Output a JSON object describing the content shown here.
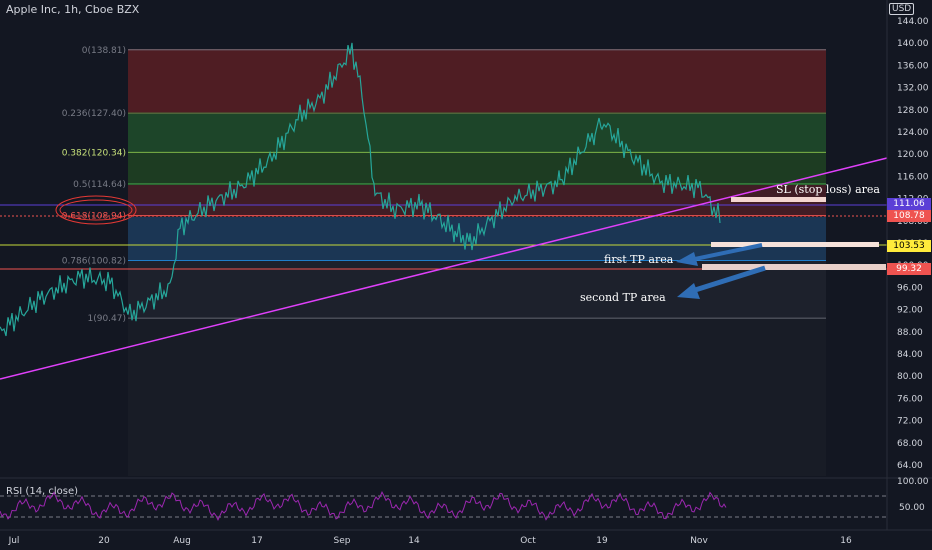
{
  "header": {
    "symbol_title": "Apple Inc, 1h, Cboe BZX",
    "currency": "USD"
  },
  "price_axis": {
    "ticks": [
      "144.00",
      "140.00",
      "136.00",
      "132.00",
      "128.00",
      "124.00",
      "120.00",
      "116.00",
      "112.00",
      "108.00",
      "104.00",
      "100.00",
      "96.00",
      "92.00",
      "88.00",
      "84.00",
      "80.00",
      "76.00",
      "72.00",
      "68.00",
      "64.00"
    ],
    "badges": [
      {
        "label": "111.06",
        "price": 111.06,
        "bg": "#5b3fd6",
        "fg": "#ffffff"
      },
      {
        "label": "108.78",
        "price": 108.78,
        "bg": "#ef5350",
        "fg": "#ffffff"
      },
      {
        "label": "103.53",
        "price": 103.53,
        "bg": "#ffeb3b",
        "fg": "#000000"
      },
      {
        "label": "99.32",
        "price": 99.32,
        "bg": "#ef5350",
        "fg": "#ffffff"
      }
    ]
  },
  "time_axis": {
    "labels": [
      "Jul",
      "20",
      "Aug",
      "17",
      "Sep",
      "14",
      "Oct",
      "19",
      "Nov",
      "16"
    ]
  },
  "fib_levels": [
    {
      "label": "0(138.81)",
      "ratio": 0,
      "price": 138.81
    },
    {
      "label": "0.236(127.40)",
      "ratio": 0.236,
      "price": 127.4
    },
    {
      "label": "0.382(120.34)",
      "ratio": 0.382,
      "price": 120.34
    },
    {
      "label": "0.5(114.64)",
      "ratio": 0.5,
      "price": 114.64
    },
    {
      "label": "0.618(108.94)",
      "ratio": 0.618,
      "price": 108.94
    },
    {
      "label": "0.786(100.82)",
      "ratio": 0.786,
      "price": 100.82
    },
    {
      "label": "1(90.47)",
      "ratio": 1,
      "price": 90.47
    }
  ],
  "annotations": {
    "sl": "SL (stop loss) area",
    "tp1": "first TP area",
    "tp2": "second TP area"
  },
  "rsi": {
    "label": "RSI (14, close)",
    "ticks": [
      "100.00",
      "50.00"
    ]
  },
  "colors": {
    "background": "#131722",
    "trendline": "#e040fb",
    "candle_up": "#26a69a",
    "candle_down": "#ef5350",
    "rsi_line": "#9c27b0"
  }
}
